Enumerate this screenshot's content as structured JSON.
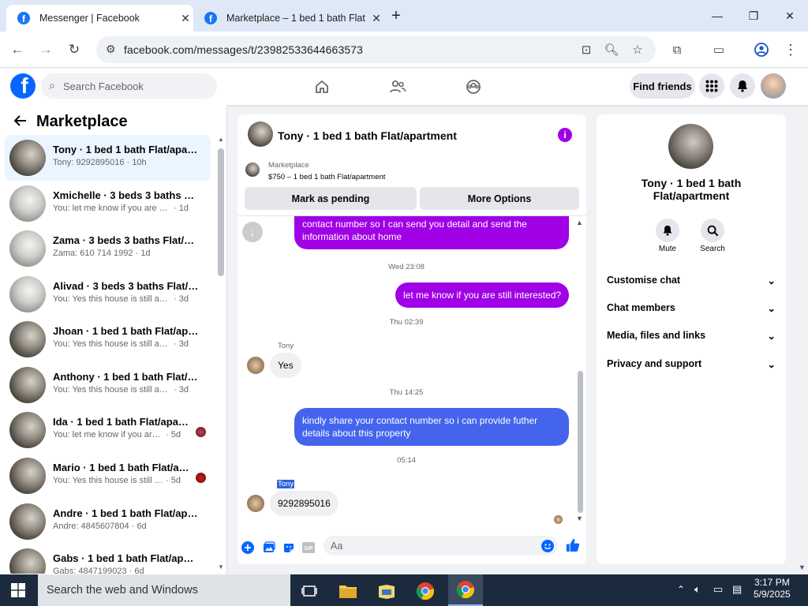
{
  "browser": {
    "tabs": [
      {
        "title": "Messenger | Facebook",
        "active": true
      },
      {
        "title": "Marketplace – 1 bed 1 bath Flat",
        "active": false
      }
    ],
    "new_tab": "+",
    "url": "facebook.com/messages/t/23982533644663573",
    "window": {
      "min": "—",
      "max": "❐",
      "close": "✕"
    }
  },
  "fb": {
    "logo": "f",
    "search_placeholder": "Search Facebook",
    "find_friends": "Find friends"
  },
  "left": {
    "title": "Marketplace",
    "conversations": [
      {
        "name": "Tony · 1 bed 1 bath Flat/apartm...",
        "preview": "Tony: 9292895016",
        "time": "· 10h",
        "selected": true
      },
      {
        "name": "Xmichelle · 3 beds 3 baths Flat/...",
        "preview": "You: let me know if you are still int...",
        "time": "· 1d"
      },
      {
        "name": "Zama · 3 beds 3 baths Flat/apar...",
        "preview": "Zama: 610 714 1992",
        "time": "· 1d"
      },
      {
        "name": "Alivad · 3 beds 3 baths Flat/apa...",
        "preview": "You: Yes this house is still available ...",
        "time": "· 3d"
      },
      {
        "name": "Jhoan · 1 bed 1 bath Flat/apart...",
        "preview": "You: Yes this house is still available ...",
        "time": "· 3d"
      },
      {
        "name": "Anthony · 1 bed 1 bath Flat/apar...",
        "preview": "You: Yes this house is still available ...",
        "time": "· 3d"
      },
      {
        "name": "Ida · 1 bed 1 bath Flat/apartm...",
        "preview": "You: let me know if you are still ...",
        "time": "· 5d"
      },
      {
        "name": "Mario · 1 bed 1 bath Flat/apar...",
        "preview": "You: Yes this house is still availa...",
        "time": "· 5d"
      },
      {
        "name": "Andre · 1 bed 1 bath Flat/apart...",
        "preview": "Andre: 4845607804",
        "time": "· 6d"
      },
      {
        "name": "Gabs · 1 bed 1 bath Flat/apartm...",
        "preview": "Gabs: 4847199023",
        "time": "· 6d"
      }
    ]
  },
  "chat": {
    "title": "Tony · 1 bed 1 bath Flat/apartment",
    "marketplace_label": "Marketplace",
    "listing": "$750 – 1 bed 1 bath Flat/apartment",
    "mark_pending": "Mark as pending",
    "more_options": "More Options",
    "messages": {
      "m1": "contact number so I can send you detail and send the information about home",
      "ts1": "Wed 23:08",
      "m2": "let me know if you are still interested?",
      "ts2": "Thu 02:39",
      "sender1": "Tony",
      "m3": "Yes",
      "ts3": "Thu 14:25",
      "m4": "kindly share your contact number so i can provide futher details about this property",
      "ts4": "05:14",
      "sender2": "Tony",
      "m5": "9292895016"
    },
    "composer_placeholder": "Aa"
  },
  "right": {
    "title": "Tony · 1 bed 1 bath Flat/apartment",
    "mute": "Mute",
    "search": "Search",
    "sections": [
      "Customise chat",
      "Chat members",
      "Media, files and links",
      "Privacy and support"
    ]
  },
  "taskbar": {
    "search": "Search the web and Windows",
    "time": "3:17 PM",
    "date": "5/9/2025"
  },
  "colors": {
    "fb_blue": "#0866ff",
    "messenger_purple": "#a000e6",
    "bubble_blue": "#4564ed"
  }
}
